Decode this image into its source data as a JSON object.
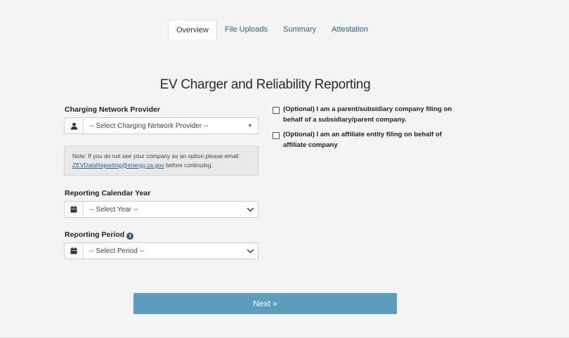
{
  "tabs": [
    {
      "label": "Overview",
      "active": true
    },
    {
      "label": "File Uploads",
      "active": false
    },
    {
      "label": "Summary",
      "active": false
    },
    {
      "label": "Attestation",
      "active": false
    }
  ],
  "page_title": "EV Charger and Reliability Reporting",
  "provider": {
    "label": "Charging Network Provider",
    "selected": "-- Select Charging Network Provider --",
    "icon": "user-icon"
  },
  "note": {
    "prefix": "Note: If you do not see your company as an option please email",
    "email": "ZEVDataReporting@energy.ca.gov",
    "suffix": "before continuing."
  },
  "year": {
    "label": "Reporting Calendar Year",
    "selected": "-- Select Year --",
    "icon": "calendar-icon"
  },
  "period": {
    "label": "Reporting Period",
    "selected": "-- Select Period --",
    "icon": "calendar-icon",
    "info_icon": "info-icon"
  },
  "options": {
    "parent_subsidiary_line1": "(Optional) I am a parent/subsidiary company filing on",
    "parent_subsidiary_line2": "behalf of a subsidiary/parent company.",
    "affiliate_line1": "(Optional) I am an affiliate entity filing on behalf of",
    "affiliate_line2": "affiliate company"
  },
  "next_button": "Next »",
  "colors": {
    "accent": "#5c9dbd",
    "link": "#2a5f8a",
    "background": "#f4f4f4"
  }
}
